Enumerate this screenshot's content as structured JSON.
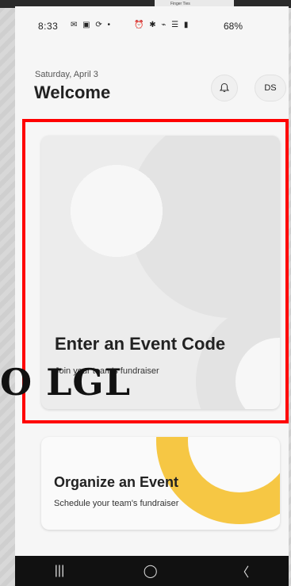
{
  "status_bar": {
    "time": "8:33",
    "battery": "68%",
    "left_icons": "✉ ▣ ⟳ •",
    "right_icons": "⏰ ✱ ⌁ ☰ ▮"
  },
  "top_strip": {
    "label": "Finger Ties"
  },
  "header": {
    "date": "Saturday, April 3",
    "title": "Welcome",
    "avatar_initials": "DS"
  },
  "cards": {
    "event": {
      "title": "Enter an Event Code",
      "subtitle": "Join your team's fundraiser"
    },
    "organize": {
      "title": "Organize an Event",
      "subtitle": "Schedule your team's fundraiser"
    }
  },
  "overlay": {
    "text": "O LGL"
  },
  "nav": {
    "recent": "|||",
    "home": "◯",
    "back": "〈"
  },
  "colors": {
    "accent": "#f6c744",
    "highlight": "#ff0000"
  },
  "icons": {
    "bell": "bell-icon"
  }
}
